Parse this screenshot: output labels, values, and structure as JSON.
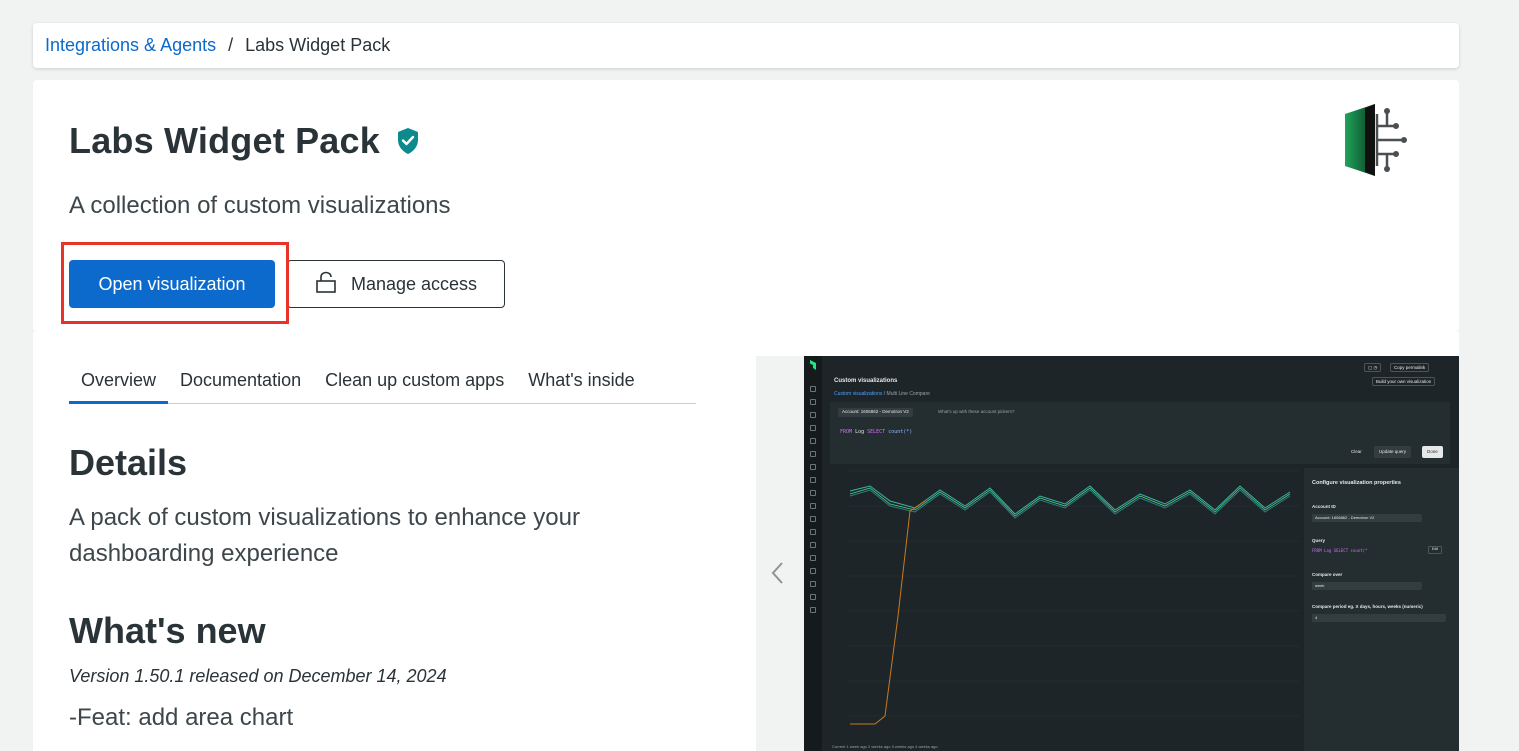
{
  "breadcrumb": {
    "parent": "Integrations & Agents",
    "separator": "/",
    "current": "Labs Widget Pack"
  },
  "header": {
    "title": "Labs Widget Pack",
    "subtitle": "A collection of custom visualizations",
    "open_button": "Open visualization",
    "manage_button": "Manage access",
    "logo_icon": "labs-widget-pack-logo",
    "verified_icon": "verified-shield-icon"
  },
  "tabs": [
    {
      "label": "Overview",
      "active": true
    },
    {
      "label": "Documentation",
      "active": false
    },
    {
      "label": "Clean up custom apps",
      "active": false
    },
    {
      "label": "What's inside",
      "active": false
    }
  ],
  "overview": {
    "details_heading": "Details",
    "details_text": "A pack of custom visualizations to enhance your dashboarding experience",
    "whats_new_heading": "What's new",
    "release_line": "Version 1.50.1 released on December 14, 2024",
    "feat_line": "-Feat: add area chart"
  },
  "screenshot": {
    "top_buttons": [
      "Copy permalink",
      "Build your own visualization"
    ],
    "title": "Custom visualizations",
    "crumb_link": "Custom visualizations",
    "crumb_sep": "/",
    "crumb_current": "Multi Line Compare",
    "account": "Account: 1606862 - Demotron V2",
    "help": "What's up with these account pickers?",
    "nrql": {
      "from": "FROM",
      "table": "Log",
      "select": "SELECT",
      "fn": "count(*)"
    },
    "clear": "Clear",
    "update": "Update query",
    "done": "Done",
    "panel": {
      "heading": "Configure visualization properties",
      "account_label": "Account ID",
      "account_value": "Account: 1606862 - Demotron V2",
      "query_label": "Query",
      "query_value": "FROM Log SELECT count(*",
      "edit": "Edit",
      "compare_label": "Compare over",
      "compare_value": "week",
      "period_label": "Compare period eg. X days, hours, weeks (numeric)",
      "period_value": "4"
    },
    "legend": "Current   1 week ago   2 weeks ago   3 weeks ago   4 weeks ago"
  },
  "colors": {
    "primary": "#0b6acb",
    "highlight": "#e8332b",
    "verified": "#0c8a8d"
  }
}
